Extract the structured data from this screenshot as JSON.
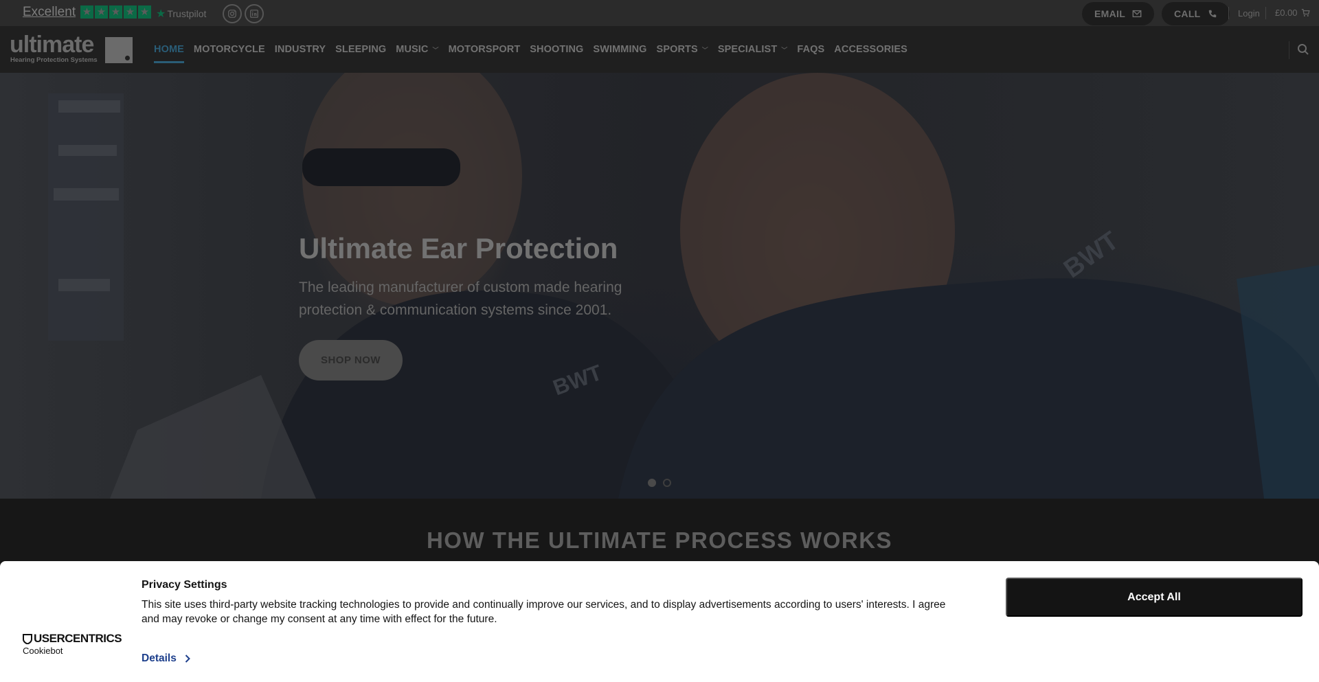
{
  "topbar": {
    "trustpilot_rating_label": "Excellent",
    "trustpilot_stars": 5,
    "trustpilot_brand": "Trustpilot",
    "social": [
      "instagram-icon",
      "linkedin-icon"
    ],
    "email_label": "EMAIL",
    "call_label": "CALL",
    "login_label": "Login",
    "cart_total": "£0.00"
  },
  "header": {
    "logo_word": "ultimate",
    "logo_sub": "Hearing Protection Systems",
    "nav": [
      {
        "label": "HOME",
        "active": true,
        "dropdown": false
      },
      {
        "label": "MOTORCYCLE",
        "dropdown": false
      },
      {
        "label": "INDUSTRY",
        "dropdown": false
      },
      {
        "label": "SLEEPING",
        "dropdown": false
      },
      {
        "label": "MUSIC",
        "dropdown": true
      },
      {
        "label": "MOTORSPORT",
        "dropdown": false
      },
      {
        "label": "SHOOTING",
        "dropdown": false
      },
      {
        "label": "SWIMMING",
        "dropdown": false
      },
      {
        "label": "SPORTS",
        "dropdown": true
      },
      {
        "label": "SPECIALIST",
        "dropdown": true
      },
      {
        "label": "FAQS",
        "dropdown": false
      },
      {
        "label": "ACCESSORIES",
        "dropdown": false
      }
    ]
  },
  "hero": {
    "title": "Ultimate Ear Protection",
    "subtitle": "The leading manufacturer of custom made hearing protection & communication systems since 2001.",
    "cta_label": "SHOP NOW",
    "slides": 2,
    "active_slide": 1
  },
  "section": {
    "title": "HOW THE ULTIMATE PROCESS WORKS"
  },
  "cookie": {
    "brand": "USERCENTRICS",
    "brand_sub": "Cookiebot",
    "title": "Privacy Settings",
    "text": "This site uses third-party website tracking technologies to provide and continually improve our services, and to display advertisements according to users' interests. I agree and may revoke or change my consent at any time with effect for the future.",
    "details_label": "Details",
    "accept_label": "Accept All"
  },
  "colors": {
    "accent": "#2a5d77",
    "trustpilot_green": "#0b6a46",
    "accept_button": "#141414"
  }
}
